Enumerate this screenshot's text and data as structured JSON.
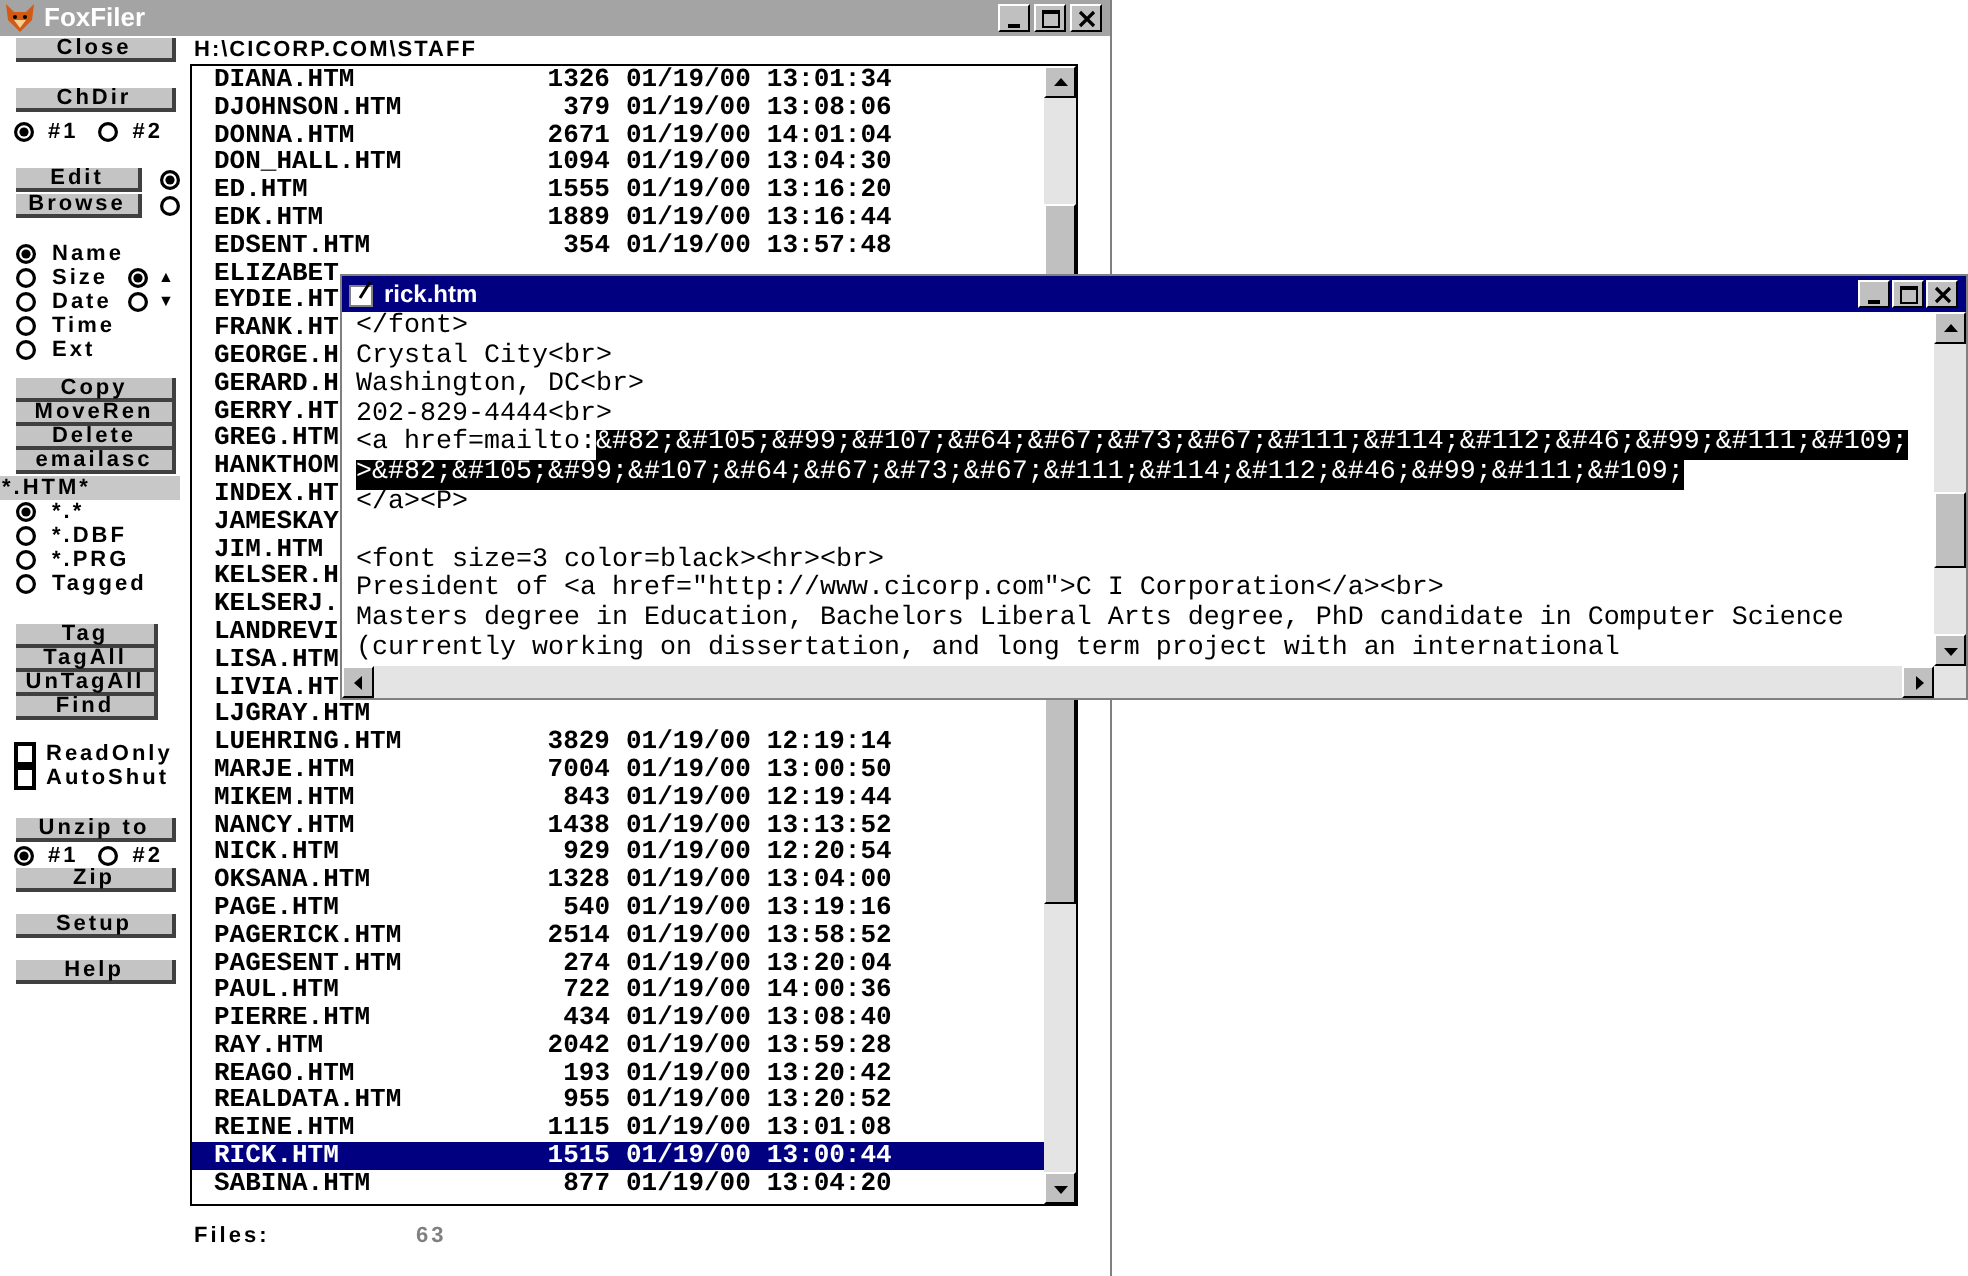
{
  "window": {
    "title": "FoxFiler"
  },
  "sidebar": {
    "close_button": "Close",
    "chdir": {
      "button": "ChDir",
      "options": [
        {
          "label": "#1",
          "selected": true
        },
        {
          "label": "#2",
          "selected": false
        }
      ]
    },
    "mode_buttons": [
      {
        "label": "Edit",
        "selected": true
      },
      {
        "label": "Browse",
        "selected": false
      }
    ],
    "sort_options": [
      {
        "label": "Name",
        "selected": true
      },
      {
        "label": "Size",
        "selected": false
      },
      {
        "label": "Date",
        "selected": false
      },
      {
        "label": "Time",
        "selected": false
      },
      {
        "label": "Ext",
        "selected": false
      }
    ],
    "sort_order": [
      {
        "label": "▲",
        "selected": true
      },
      {
        "label": "▼",
        "selected": false
      }
    ],
    "action_buttons": [
      "Copy",
      "MoveRen",
      "Delete",
      "emailasc"
    ],
    "filter": "*.HTM*",
    "filter_options": [
      {
        "label": "*.*",
        "selected": true
      },
      {
        "label": "*.DBF",
        "selected": false
      },
      {
        "label": "*.PRG",
        "selected": false
      },
      {
        "label": "Tagged",
        "selected": false
      }
    ],
    "tag_buttons": [
      "Tag",
      "TagAll",
      "UnTagAll",
      "Find"
    ],
    "checkboxes": [
      {
        "label": "ReadOnly",
        "checked": false
      },
      {
        "label": "AutoShut",
        "checked": false
      }
    ],
    "unzip": {
      "button": "Unzip to",
      "options": [
        {
          "label": "#1",
          "selected": true
        },
        {
          "label": "#2",
          "selected": false
        }
      ]
    },
    "zip_button": "Zip",
    "bottom_buttons": [
      "Setup",
      "Help"
    ]
  },
  "path": "H:\\CICORP.COM\\STAFF",
  "files": [
    {
      "name": "DIANA.HTM",
      "size": "1326",
      "date": "01/19/00",
      "time": "13:01:34",
      "selected": false
    },
    {
      "name": "DJOHNSON.HTM",
      "size": "379",
      "date": "01/19/00",
      "time": "13:08:06",
      "selected": false
    },
    {
      "name": "DONNA.HTM",
      "size": "2671",
      "date": "01/19/00",
      "time": "14:01:04",
      "selected": false
    },
    {
      "name": "DON_HALL.HTM",
      "size": "1094",
      "date": "01/19/00",
      "time": "13:04:30",
      "selected": false
    },
    {
      "name": "ED.HTM",
      "size": "1555",
      "date": "01/19/00",
      "time": "13:16:20",
      "selected": false
    },
    {
      "name": "EDK.HTM",
      "size": "1889",
      "date": "01/19/00",
      "time": "13:16:44",
      "selected": false
    },
    {
      "name": "EDSENT.HTM",
      "size": "354",
      "date": "01/19/00",
      "time": "13:57:48",
      "selected": false
    },
    {
      "name": "ELIZABET",
      "selected": false
    },
    {
      "name": "EYDIE.HT",
      "selected": false
    },
    {
      "name": "FRANK.HT",
      "selected": false
    },
    {
      "name": "GEORGE.H",
      "selected": false
    },
    {
      "name": "GERARD.H",
      "selected": false
    },
    {
      "name": "GERRY.HT",
      "selected": false
    },
    {
      "name": "GREG.HTM",
      "selected": false
    },
    {
      "name": "HANKTHOM",
      "selected": false
    },
    {
      "name": "INDEX.HT",
      "selected": false
    },
    {
      "name": "JAMESKAY",
      "selected": false
    },
    {
      "name": "JIM.HTM",
      "selected": false
    },
    {
      "name": "KELSER.H",
      "selected": false
    },
    {
      "name": "KELSERJ.",
      "selected": false
    },
    {
      "name": "LANDREVI",
      "selected": false
    },
    {
      "name": "LISA.HTM",
      "selected": false
    },
    {
      "name": "LIVIA.HT",
      "selected": false
    },
    {
      "name": "LJGRAY.HTM",
      "selected": false
    },
    {
      "name": "LUEHRING.HTM",
      "size": "3829",
      "date": "01/19/00",
      "time": "12:19:14",
      "selected": false
    },
    {
      "name": "MARJE.HTM",
      "size": "7004",
      "date": "01/19/00",
      "time": "13:00:50",
      "selected": false
    },
    {
      "name": "MIKEM.HTM",
      "size": "843",
      "date": "01/19/00",
      "time": "12:19:44",
      "selected": false
    },
    {
      "name": "NANCY.HTM",
      "size": "1438",
      "date": "01/19/00",
      "time": "13:13:52",
      "selected": false
    },
    {
      "name": "NICK.HTM",
      "size": "929",
      "date": "01/19/00",
      "time": "12:20:54",
      "selected": false
    },
    {
      "name": "OKSANA.HTM",
      "size": "1328",
      "date": "01/19/00",
      "time": "13:04:00",
      "selected": false
    },
    {
      "name": "PAGE.HTM",
      "size": "540",
      "date": "01/19/00",
      "time": "13:19:16",
      "selected": false
    },
    {
      "name": "PAGERICK.HTM",
      "size": "2514",
      "date": "01/19/00",
      "time": "13:58:52",
      "selected": false
    },
    {
      "name": "PAGESENT.HTM",
      "size": "274",
      "date": "01/19/00",
      "time": "13:20:04",
      "selected": false
    },
    {
      "name": "PAUL.HTM",
      "size": "722",
      "date": "01/19/00",
      "time": "14:00:36",
      "selected": false
    },
    {
      "name": "PIERRE.HTM",
      "size": "434",
      "date": "01/19/00",
      "time": "13:08:40",
      "selected": false
    },
    {
      "name": "RAY.HTM",
      "size": "2042",
      "date": "01/19/00",
      "time": "13:59:28",
      "selected": false
    },
    {
      "name": "REAGO.HTM",
      "size": "193",
      "date": "01/19/00",
      "time": "13:20:42",
      "selected": false
    },
    {
      "name": "REALDATA.HTM",
      "size": "955",
      "date": "01/19/00",
      "time": "13:20:52",
      "selected": false
    },
    {
      "name": "REINE.HTM",
      "size": "1115",
      "date": "01/19/00",
      "time": "13:01:08",
      "selected": false
    },
    {
      "name": "RICK.HTM",
      "size": "1515",
      "date": "01/19/00",
      "time": "13:00:44",
      "selected": true
    },
    {
      "name": "SABINA.HTM",
      "size": "877",
      "date": "01/19/00",
      "time": "13:04:20",
      "selected": false
    }
  ],
  "footer": {
    "label": "Files:",
    "count": "63"
  },
  "editor": {
    "title": "rick.htm",
    "lines": [
      {
        "kind": "text",
        "segments": [
          {
            "text": "</font>",
            "selected": false
          }
        ]
      },
      {
        "kind": "text",
        "segments": [
          {
            "text": "Crystal City<br>",
            "selected": false
          }
        ]
      },
      {
        "kind": "text",
        "segments": [
          {
            "text": "Washington, DC<br>",
            "selected": false
          }
        ]
      },
      {
        "kind": "text",
        "segments": [
          {
            "text": "202-829-4444<br>",
            "selected": false
          }
        ]
      },
      {
        "kind": "text",
        "segments": [
          {
            "text": "<a href=mailto:",
            "selected": false
          },
          {
            "text": "&#82;&#105;&#99;&#107;&#64;&#67;&#73;&#67;&#111;&#114;&#112;&#46;&#99;&#111;&#109;",
            "selected": true
          }
        ]
      },
      {
        "kind": "text",
        "segments": [
          {
            "text": ">&#82;&#105;&#99;&#107;&#64;&#67;&#73;&#67;&#111;&#114;&#112;&#46;&#99;&#111;&#109;",
            "selected": true
          }
        ]
      },
      {
        "kind": "text",
        "segments": [
          {
            "text": "</a><P>",
            "selected": false
          }
        ]
      },
      {
        "kind": "blank"
      },
      {
        "kind": "text",
        "segments": [
          {
            "text": "<font size=3 color=black><hr><br>",
            "selected": false
          }
        ]
      },
      {
        "kind": "text",
        "segments": [
          {
            "text": "President of <a href=\"http://www.cicorp.com\">C I Corporation</a><br>",
            "selected": false
          }
        ]
      },
      {
        "kind": "text",
        "segments": [
          {
            "text": "Masters degree in Education, Bachelors Liberal Arts degree, PhD candidate in Computer Science",
            "selected": false
          }
        ]
      },
      {
        "kind": "text",
        "segments": [
          {
            "text": "(currently working on dissertation, and long term project with an international",
            "selected": false
          }
        ]
      }
    ]
  }
}
